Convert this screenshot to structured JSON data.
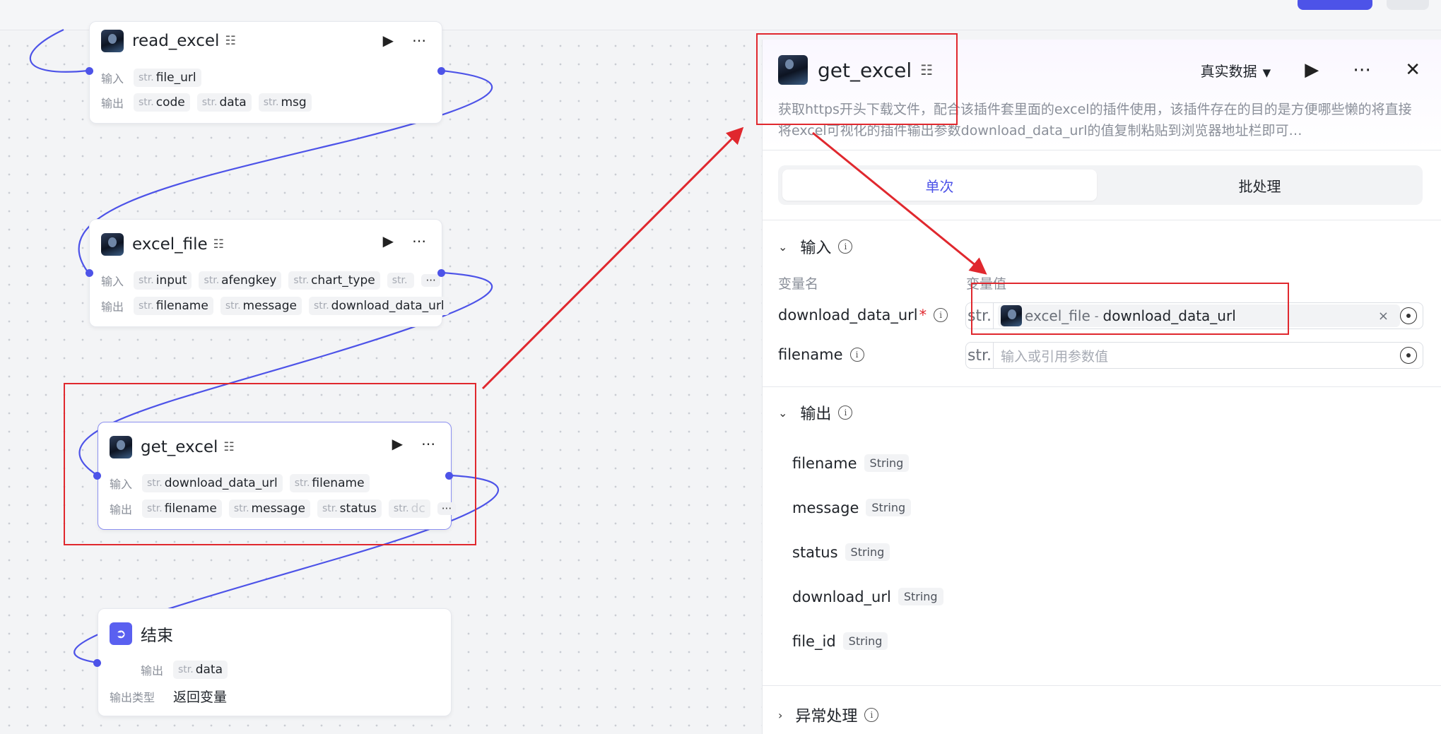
{
  "canvas": {
    "nodes": {
      "read_excel": {
        "title": "read_excel",
        "input_label": "输入",
        "output_label": "输出",
        "inputs": [
          {
            "type": "str.",
            "name": "file_url"
          }
        ],
        "outputs": [
          {
            "type": "str.",
            "name": "code"
          },
          {
            "type": "str.",
            "name": "data"
          },
          {
            "type": "str.",
            "name": "msg"
          }
        ]
      },
      "excel_file": {
        "title": "excel_file",
        "input_label": "输入",
        "output_label": "输出",
        "inputs": [
          {
            "type": "str.",
            "name": "input"
          },
          {
            "type": "str.",
            "name": "afengkey"
          },
          {
            "type": "str.",
            "name": "chart_type"
          },
          {
            "type": "str.",
            "name": ""
          }
        ],
        "outputs": [
          {
            "type": "str.",
            "name": "filename"
          },
          {
            "type": "str.",
            "name": "message"
          },
          {
            "type": "str.",
            "name": "download_data_url"
          }
        ],
        "more": "···"
      },
      "get_excel": {
        "title": "get_excel",
        "input_label": "输入",
        "output_label": "输出",
        "inputs": [
          {
            "type": "str.",
            "name": "download_data_url"
          },
          {
            "type": "str.",
            "name": "filename"
          }
        ],
        "outputs": [
          {
            "type": "str.",
            "name": "filename"
          },
          {
            "type": "str.",
            "name": "message"
          },
          {
            "type": "str.",
            "name": "status"
          },
          {
            "type": "str.",
            "name": "dc"
          }
        ],
        "more": "···"
      },
      "end": {
        "title": "结束",
        "output_label": "输出",
        "output_type_label": "输出类型",
        "outputs": [
          {
            "type": "str.",
            "name": "data"
          }
        ],
        "output_type_value": "返回变量"
      }
    }
  },
  "panel": {
    "title": "get_excel",
    "mode": "真实数据",
    "description": "获取https开头下载文件，配合该插件套里面的excel的插件使用，该插件存在的目的是方便哪些懒的将直接将excel可视化的插件输出参数download_data_url的值复制粘贴到浏览器地址栏即可…",
    "tabs": {
      "single": "单次",
      "batch": "批处理"
    },
    "input_section": "输入",
    "col_name": "变量名",
    "col_value": "变量值",
    "params": [
      {
        "name": "download_data_url",
        "required": "*",
        "prefix": "str.",
        "ref_node": "excel_file",
        "ref_sep": "-",
        "ref_var": "download_data_url",
        "clear": "×"
      },
      {
        "name": "filename",
        "prefix": "str.",
        "placeholder": "输入或引用参数值"
      }
    ],
    "output_section": "输出",
    "outputs": [
      {
        "name": "filename",
        "type": "String"
      },
      {
        "name": "message",
        "type": "String"
      },
      {
        "name": "status",
        "type": "String"
      },
      {
        "name": "download_url",
        "type": "String"
      },
      {
        "name": "file_id",
        "type": "String"
      }
    ],
    "exception_section": "异常处理"
  },
  "icons": {
    "run": "play-icon",
    "more": "more-dots-icon",
    "close": "close-icon",
    "plugin": "plugin-icon",
    "info": "info-icon",
    "chevron": "chevron-icon",
    "target": "reference-target-icon"
  },
  "colors": {
    "accent": "#4d53e8",
    "annotation": "#e0282e",
    "wire": "#4d53e8"
  }
}
